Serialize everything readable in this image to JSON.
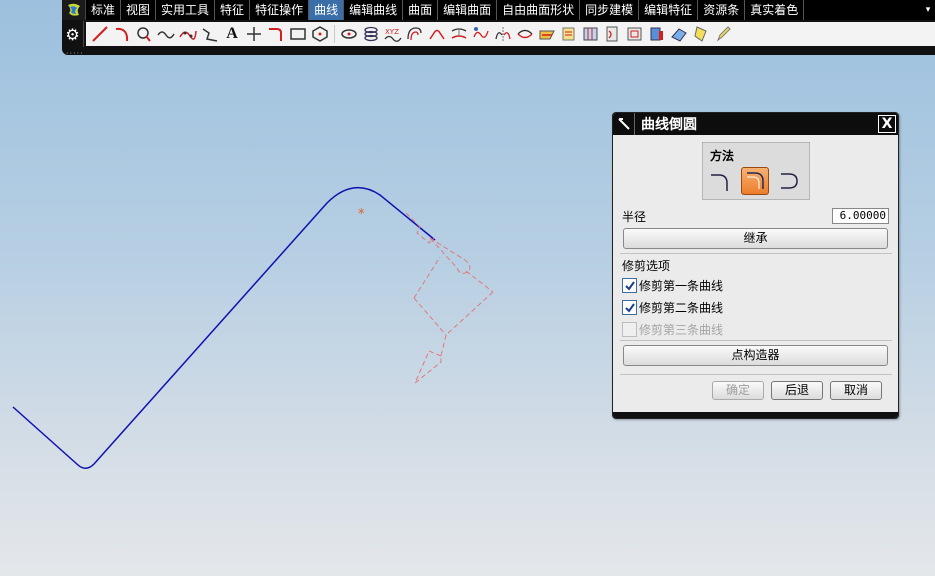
{
  "menu": {
    "tabs": [
      "标准",
      "视图",
      "实用工具",
      "特征",
      "特征操作",
      "曲线",
      "编辑曲线",
      "曲面",
      "编辑曲面",
      "自由曲面形状",
      "同步建模",
      "编辑特征",
      "资源条",
      "真实着色"
    ],
    "active_tab": "曲线",
    "overflow_icon": "dropdown-arrow-icon"
  },
  "toolbar": {
    "settings_icon": "gear-icon",
    "text_tool_label": "A",
    "icons": [
      "line",
      "arc",
      "circle",
      "spline",
      "studio-spline",
      "polyline",
      "text",
      "point",
      "fillet",
      "rectangle",
      "polygon",
      "ellipse",
      "helix",
      "law-curve",
      "offset",
      "bridge",
      "project",
      "combined",
      "intersect",
      "section",
      "extract",
      "isoparametric",
      "wrap",
      "silhouette",
      "shadow",
      "edge",
      "face",
      "pencil"
    ]
  },
  "viewport": {
    "background_top": "#9cc0de",
    "background_bottom": "#e4e7ea",
    "curve_color": "#1010b0",
    "preview_color": "#e07a7a",
    "center_marker": "*"
  },
  "dialog": {
    "title": "曲线倒圆",
    "close_label": "X",
    "method": {
      "label": "方法",
      "options": [
        "simple-fillet",
        "two-curve-fillet",
        "three-curve-fillet"
      ],
      "selected": "two-curve-fillet"
    },
    "radius_label": "半径",
    "radius_value": "6.00000",
    "inherit_button": "继承",
    "trim_section": "修剪选项",
    "trim_options": [
      {
        "label": "修剪第一条曲线",
        "checked": true,
        "enabled": true
      },
      {
        "label": "修剪第二条曲线",
        "checked": true,
        "enabled": true
      },
      {
        "label": "修剪第三条曲线",
        "checked": false,
        "enabled": false
      }
    ],
    "point_constructor_button": "点构造器",
    "ok_button": "确定",
    "back_button": "后退",
    "cancel_button": "取消"
  }
}
